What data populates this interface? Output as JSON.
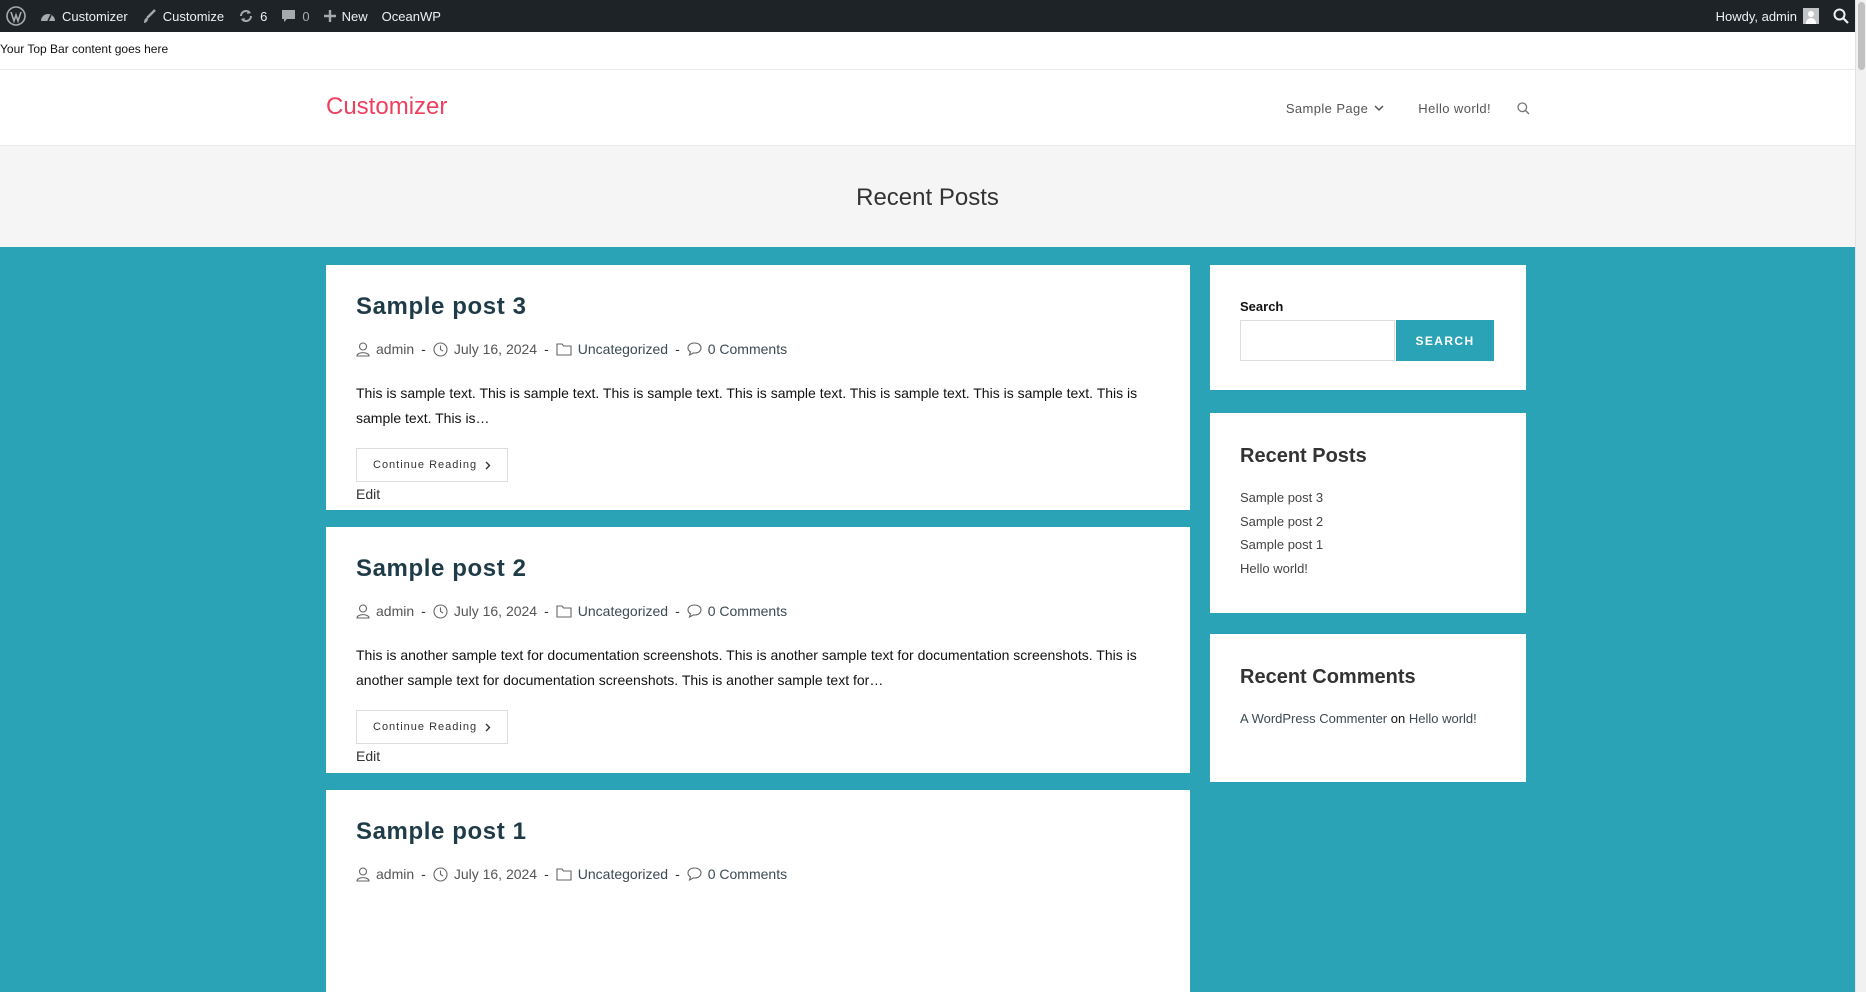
{
  "admin_bar": {
    "site_name": "Customizer",
    "customize": "Customize",
    "updates_count": "6",
    "comments_count": "0",
    "new_label": "New",
    "theme_label": "OceanWP",
    "howdy": "Howdy, admin"
  },
  "top_bar": {
    "text": "Your Top Bar content goes here"
  },
  "header": {
    "logo": "Customizer",
    "nav": [
      {
        "label": "Sample Page"
      },
      {
        "label": "Hello world!"
      }
    ]
  },
  "page_title": "Recent Posts",
  "posts": [
    {
      "title": "Sample post 3",
      "author": "admin",
      "date": "July 16, 2024",
      "category": "Uncategorized",
      "comments": "0 Comments",
      "excerpt": "This is sample text. This is sample text. This is sample text. This is sample text. This is sample text. This is sample text. This is sample text. This is…",
      "more": "Continue Reading",
      "edit": "Edit"
    },
    {
      "title": "Sample post 2",
      "author": "admin",
      "date": "July 16, 2024",
      "category": "Uncategorized",
      "comments": "0 Comments",
      "excerpt": "This is another sample text for documentation screenshots. This is another sample text for documentation screenshots. This is another sample text for documentation screenshots. This is another sample text for…",
      "more": "Continue Reading",
      "edit": "Edit"
    },
    {
      "title": "Sample post 1",
      "author": "admin",
      "date": "July 16, 2024",
      "category": "Uncategorized",
      "comments": "0 Comments"
    }
  ],
  "sidebar": {
    "search": {
      "label": "Search",
      "button": "SEARCH",
      "value": ""
    },
    "recent_posts": {
      "title": "Recent Posts",
      "items": [
        "Sample post 3",
        "Sample post 2",
        "Sample post 1",
        "Hello world!"
      ]
    },
    "recent_comments": {
      "title": "Recent Comments",
      "author": "A WordPress Commenter",
      "on": "on",
      "post": "Hello world!"
    }
  },
  "colors": {
    "accent": "#2aa3b6",
    "logo": "#ee3f5e",
    "admin_bar": "#1d2327"
  }
}
